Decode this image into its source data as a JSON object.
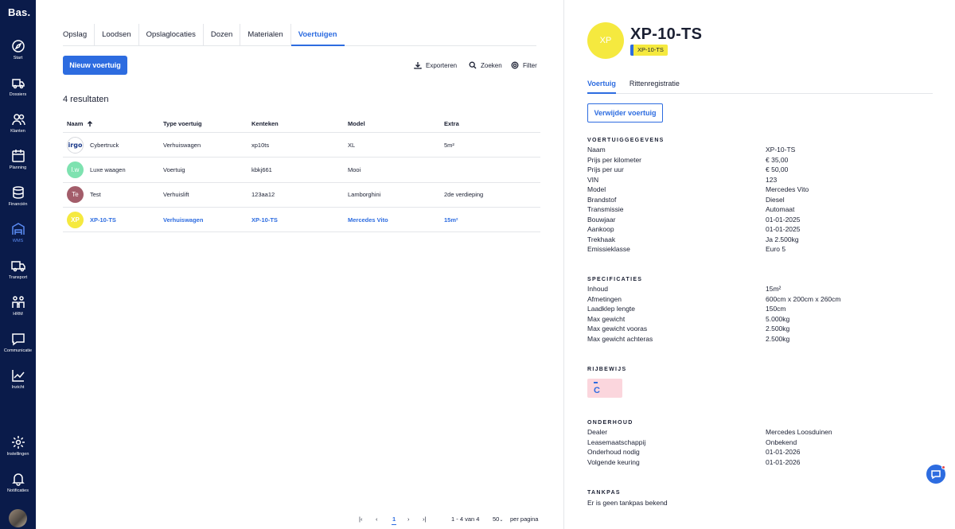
{
  "app": {
    "logo": "Bas."
  },
  "sidebar": {
    "items": [
      {
        "label": "Start",
        "icon": "compass-icon"
      },
      {
        "label": "Dossiers",
        "icon": "truck-icon"
      },
      {
        "label": "Klanten",
        "icon": "users-icon"
      },
      {
        "label": "Planning",
        "icon": "calendar-icon"
      },
      {
        "label": "Financiën",
        "icon": "coins-icon"
      },
      {
        "label": "WMS",
        "icon": "warehouse-icon"
      },
      {
        "label": "Transport",
        "icon": "transport-icon"
      },
      {
        "label": "HRM",
        "icon": "hrm-icon"
      },
      {
        "label": "Communicatie",
        "icon": "chat-icon"
      },
      {
        "label": "Inzicht",
        "icon": "chart-icon"
      },
      {
        "label": "Instellingen",
        "icon": "gear-icon"
      },
      {
        "label": "Notificaties",
        "icon": "bell-icon"
      }
    ],
    "active_color": "#5b8cf5"
  },
  "main": {
    "tabs": [
      "Opslag",
      "Loodsen",
      "Opslaglocaties",
      "Dozen",
      "Materialen",
      "Voertuigen"
    ],
    "active_tab": "Voertuigen",
    "new_button": "Nieuw voertuig",
    "export": "Exporteren",
    "search": "Zoeken",
    "filter": "Filter",
    "results": "4 resultaten",
    "columns": [
      "Naam",
      "Type voertuig",
      "Kenteken",
      "Model",
      "Extra"
    ],
    "rows": [
      {
        "avatar": "irgo",
        "name": "Cybertruck",
        "type": "Verhuiswagen",
        "plate": "xp10ts",
        "model": "XL",
        "extra": "5m²"
      },
      {
        "avatar": "l.w",
        "name": "Luxe waagen",
        "type": "Voertuig",
        "plate": "kbkj661",
        "model": "Mooi",
        "extra": ""
      },
      {
        "avatar": "Te",
        "name": "Test",
        "type": "Verhuislift",
        "plate": "123aa12",
        "model": "Lamborghini",
        "extra": "2de verdieping"
      },
      {
        "avatar": "XP",
        "name": "XP-10-TS",
        "type": "Verhuiswagen",
        "plate": "XP-10-TS",
        "model": "Mercedes Vito",
        "extra": "15m²"
      }
    ],
    "pager": {
      "current": "1",
      "range": "1 - 4 van 4",
      "per_page": "50",
      "per_page_label": "per pagina"
    }
  },
  "detail": {
    "avatar": "XP",
    "title": "XP-10-TS",
    "plate": "XP-10-TS",
    "tabs": [
      "Voertuig",
      "Rittenregistratie"
    ],
    "delete_button": "Verwijder voertuig",
    "sections": {
      "vehicle": {
        "title": "VOERTUIGGEGEVENS",
        "rows": [
          {
            "k": "Naam",
            "v": "XP-10-TS"
          },
          {
            "k": "Prijs per kilometer",
            "v": "€ 35,00"
          },
          {
            "k": "Prijs per uur",
            "v": "€ 50,00"
          },
          {
            "k": "VIN",
            "v": "123"
          },
          {
            "k": "Model",
            "v": "Mercedes Vito"
          },
          {
            "k": "Brandstof",
            "v": "Diesel"
          },
          {
            "k": "Transmissie",
            "v": "Automaat"
          },
          {
            "k": "Bouwjaar",
            "v": "01-01-2025"
          },
          {
            "k": "Aankoop",
            "v": "01-01-2025"
          },
          {
            "k": "Trekhaak",
            "v": "Ja 2.500kg"
          },
          {
            "k": "Emissieklasse",
            "v": "Euro 5"
          }
        ]
      },
      "specs": {
        "title": "SPECIFICATIES",
        "rows": [
          {
            "k": "Inhoud",
            "v": "15m²"
          },
          {
            "k": "Afmetingen",
            "v": "600cm x 200cm x 260cm"
          },
          {
            "k": "Laadklep lengte",
            "v": "150cm"
          },
          {
            "k": "Max gewicht",
            "v": "5.000kg"
          },
          {
            "k": "Max gewicht vooras",
            "v": "2.500kg"
          },
          {
            "k": "Max gewicht achteras",
            "v": "2.500kg"
          }
        ]
      },
      "license": {
        "title": "RIJBEWIJS",
        "value": "C"
      },
      "maintenance": {
        "title": "ONDERHOUD",
        "rows": [
          {
            "k": "Dealer",
            "v": "Mercedes Loosduinen"
          },
          {
            "k": "Leasemaatschappij",
            "v": "Onbekend"
          },
          {
            "k": "Onderhoud nodig",
            "v": "01-01-2026"
          },
          {
            "k": "Volgende keuring",
            "v": "01-01-2026"
          }
        ]
      },
      "tank": {
        "title": "TANKPAS",
        "text": "Er is geen tankpas bekend"
      }
    }
  },
  "colors": {
    "primary": "#2d6ce0",
    "sidebar": "#0a1b4a",
    "plate": "#f5e93f",
    "license_bg": "#fbd6dd"
  }
}
